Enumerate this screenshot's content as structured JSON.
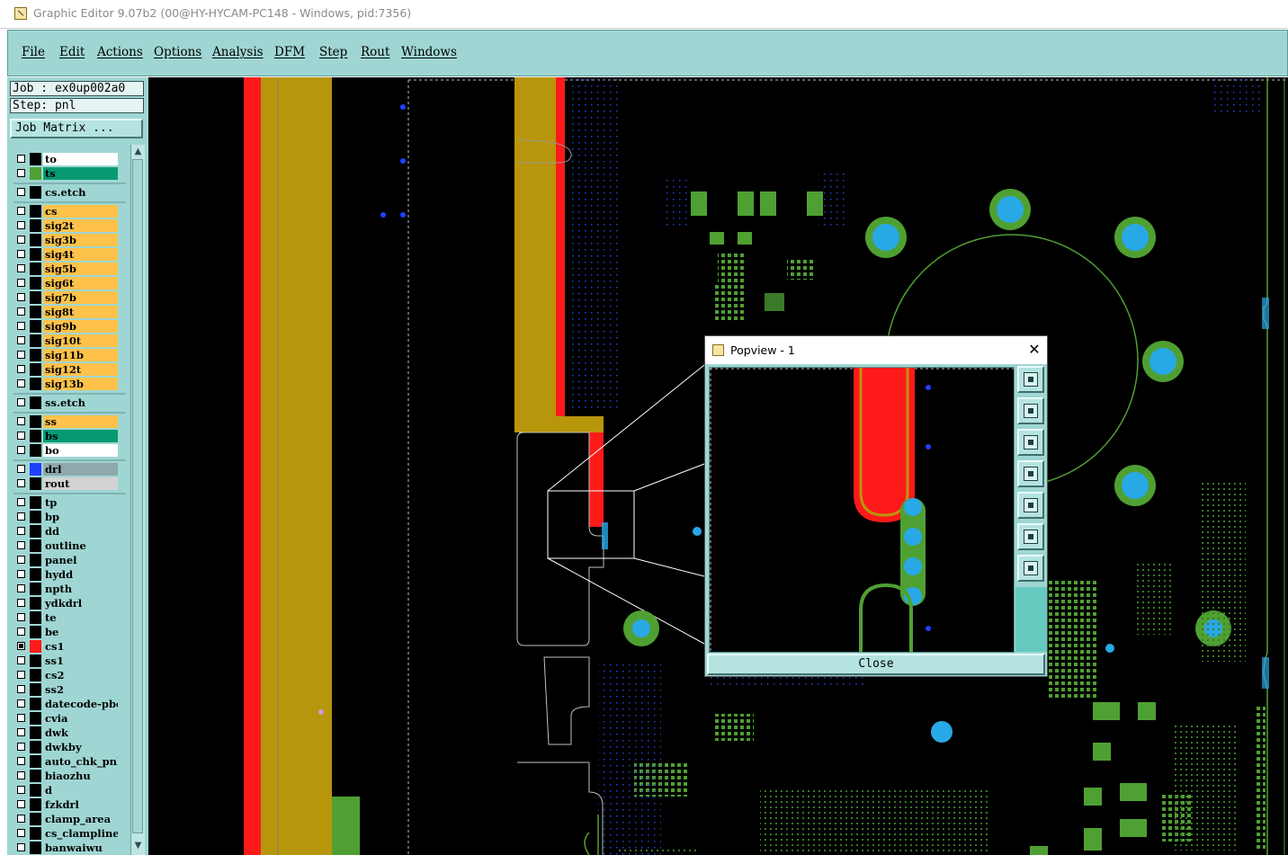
{
  "window": {
    "title": "Graphic Editor 9.07b2 (00@HY-HYCAM-PC148 - Windows, pid:7356)"
  },
  "menu": [
    "File",
    "Edit",
    "Actions",
    "Options",
    "Analysis",
    "DFM",
    "Step",
    "Rout",
    "Windows"
  ],
  "panel": {
    "job": "Job : ex0up002a0",
    "step": "Step: pnl",
    "job_matrix": "Job Matrix ..."
  },
  "layers": [
    {
      "name": "to",
      "color": "#ffffff",
      "swatch": "#000000",
      "checked": false
    },
    {
      "name": "ts",
      "color": "#079a72",
      "swatch": "#4fa032",
      "checked": false
    },
    {
      "name": "cs.etch",
      "color": "#9fd6d3",
      "swatch": "#000000",
      "checked": false
    },
    {
      "name": "cs",
      "color": "#ffc24a",
      "swatch": "#000000",
      "checked": false
    },
    {
      "name": "sig2t",
      "color": "#ffc24a",
      "swatch": "#000000",
      "checked": false
    },
    {
      "name": "sig3b",
      "color": "#ffc24a",
      "swatch": "#000000",
      "checked": false
    },
    {
      "name": "sig4t",
      "color": "#ffc24a",
      "swatch": "#000000",
      "checked": false
    },
    {
      "name": "sig5b",
      "color": "#ffc24a",
      "swatch": "#000000",
      "checked": false
    },
    {
      "name": "sig6t",
      "color": "#ffc24a",
      "swatch": "#000000",
      "checked": false
    },
    {
      "name": "sig7b",
      "color": "#ffc24a",
      "swatch": "#000000",
      "checked": false
    },
    {
      "name": "sig8t",
      "color": "#ffc24a",
      "swatch": "#000000",
      "checked": false
    },
    {
      "name": "sig9b",
      "color": "#ffc24a",
      "swatch": "#000000",
      "checked": false
    },
    {
      "name": "sig10t",
      "color": "#ffc24a",
      "swatch": "#000000",
      "checked": false
    },
    {
      "name": "sig11b",
      "color": "#ffc24a",
      "swatch": "#000000",
      "checked": false
    },
    {
      "name": "sig12t",
      "color": "#ffc24a",
      "swatch": "#000000",
      "checked": false
    },
    {
      "name": "sig13b",
      "color": "#ffc24a",
      "swatch": "#000000",
      "checked": false
    },
    {
      "name": "ss.etch",
      "color": "#9fd6d3",
      "swatch": "#000000",
      "checked": false
    },
    {
      "name": "ss",
      "color": "#ffc24a",
      "swatch": "#000000",
      "checked": false
    },
    {
      "name": "bs",
      "color": "#079a72",
      "swatch": "#000000",
      "checked": false
    },
    {
      "name": "bo",
      "color": "#ffffff",
      "swatch": "#000000",
      "checked": false
    },
    {
      "name": "drl",
      "color": "#8fa8ad",
      "swatch": "#1f3fff",
      "checked": false
    },
    {
      "name": "rout",
      "color": "#d3d3d3",
      "swatch": "#000000",
      "checked": false
    },
    {
      "name": "tp",
      "color": "#9fd6d3",
      "swatch": "#000000",
      "checked": false
    },
    {
      "name": "bp",
      "color": "#9fd6d3",
      "swatch": "#000000",
      "checked": false
    },
    {
      "name": "dd",
      "color": "#9fd6d3",
      "swatch": "#000000",
      "checked": false
    },
    {
      "name": "outline",
      "color": "#9fd6d3",
      "swatch": "#000000",
      "checked": false
    },
    {
      "name": "panel",
      "color": "#9fd6d3",
      "swatch": "#000000",
      "checked": false
    },
    {
      "name": "hydd",
      "color": "#9fd6d3",
      "swatch": "#000000",
      "checked": false
    },
    {
      "name": "npth",
      "color": "#9fd6d3",
      "swatch": "#000000",
      "checked": false
    },
    {
      "name": "ydkdrl",
      "color": "#9fd6d3",
      "swatch": "#000000",
      "checked": false
    },
    {
      "name": "te",
      "color": "#9fd6d3",
      "swatch": "#000000",
      "checked": false
    },
    {
      "name": "be",
      "color": "#9fd6d3",
      "swatch": "#000000",
      "checked": false
    },
    {
      "name": "cs1",
      "color": "#9fd6d3",
      "swatch": "#ff1a1a",
      "checked": true
    },
    {
      "name": "ss1",
      "color": "#9fd6d3",
      "swatch": "#000000",
      "checked": false
    },
    {
      "name": "cs2",
      "color": "#9fd6d3",
      "swatch": "#000000",
      "checked": false
    },
    {
      "name": "ss2",
      "color": "#9fd6d3",
      "swatch": "#000000",
      "checked": false
    },
    {
      "name": "datecode-pbe",
      "color": "#9fd6d3",
      "swatch": "#000000",
      "checked": false
    },
    {
      "name": "cvia",
      "color": "#9fd6d3",
      "swatch": "#000000",
      "checked": false
    },
    {
      "name": "dwk",
      "color": "#9fd6d3",
      "swatch": "#000000",
      "checked": false
    },
    {
      "name": "dwkby",
      "color": "#9fd6d3",
      "swatch": "#000000",
      "checked": false
    },
    {
      "name": "auto_chk_pnl",
      "color": "#9fd6d3",
      "swatch": "#000000",
      "checked": false
    },
    {
      "name": "biaozhu",
      "color": "#9fd6d3",
      "swatch": "#000000",
      "checked": false
    },
    {
      "name": "d",
      "color": "#9fd6d3",
      "swatch": "#000000",
      "checked": false
    },
    {
      "name": "fzkdrl",
      "color": "#9fd6d3",
      "swatch": "#000000",
      "checked": false
    },
    {
      "name": "clamp_area",
      "color": "#9fd6d3",
      "swatch": "#000000",
      "checked": false
    },
    {
      "name": "cs_clampline",
      "color": "#9fd6d3",
      "swatch": "#000000",
      "checked": false
    },
    {
      "name": "banwaiwu",
      "color": "#9fd6d3",
      "swatch": "#000000",
      "checked": false
    }
  ],
  "popview": {
    "title": "Popview - 1",
    "close_glyph": "✕",
    "close_button": "Close",
    "tool_icons": [
      "zoom-home-icon",
      "pan-up-icon",
      "pan-down-icon",
      "pan-left-icon",
      "pan-right-icon",
      "zoom-fit-icon",
      "zoom-center-icon"
    ]
  },
  "colors": {
    "panel_bg": "#9fd6d3",
    "canvas_bg": "#000000",
    "copper": "#b8960c",
    "red": "#ff1a1a",
    "pad_green": "#4fa032",
    "drill_cyan": "#29a8e6",
    "via_blue": "#1f3fff"
  }
}
